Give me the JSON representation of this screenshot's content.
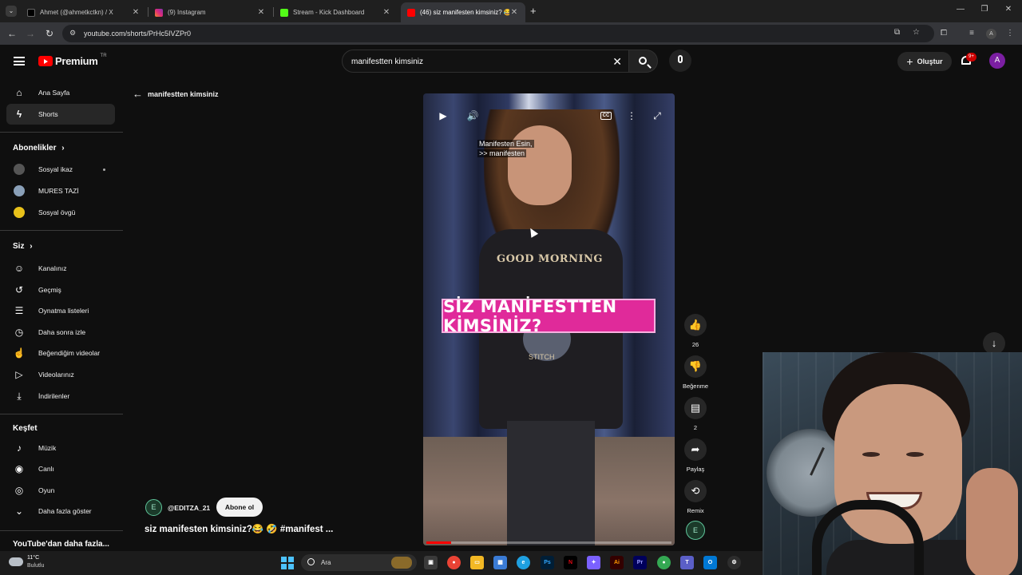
{
  "browser": {
    "tabs": [
      {
        "title": "Ahmet (@ahmetkctkn) / X",
        "icon_color": "#000000"
      },
      {
        "title": "(9) Instagram",
        "icon_color": "#e1306c"
      },
      {
        "title": "Stream - Kick Dashboard",
        "icon_color": "#53fc18"
      },
      {
        "title": "(46) siz manifesten kimsiniz? 😂",
        "icon_color": "#ff0000"
      }
    ],
    "url": "youtube.com/shorts/PrHc5IVZPr0"
  },
  "header": {
    "brand": "Premium",
    "region": "TR",
    "search_value": "manifestten kimsiniz",
    "create_label": "Oluştur",
    "notif_count": "9+",
    "avatar_letter": "A"
  },
  "sidebar": {
    "main": [
      {
        "label": "Ana Sayfa",
        "icon": "home-icon"
      },
      {
        "label": "Shorts",
        "icon": "shorts-icon"
      }
    ],
    "subscriptions_heading": "Abonelikler",
    "subscriptions": [
      {
        "label": "Sosyal ikaz",
        "color": "#555555"
      },
      {
        "label": "MURES TAZİ",
        "color": "#8aa0b8"
      },
      {
        "label": "Sosyal övgü",
        "color": "#e8c11a"
      }
    ],
    "you_heading": "Siz",
    "you": [
      {
        "label": "Kanalınız",
        "icon": "channel-icon",
        "glyph": "☺"
      },
      {
        "label": "Geçmiş",
        "icon": "history-icon",
        "glyph": "↺"
      },
      {
        "label": "Oynatma listeleri",
        "icon": "playlist-icon",
        "glyph": "☰"
      },
      {
        "label": "Daha sonra izle",
        "icon": "clock-icon",
        "glyph": "◷"
      },
      {
        "label": "Beğendiğim videolar",
        "icon": "thumbs-up-icon",
        "glyph": "👍"
      },
      {
        "label": "Videolarınız",
        "icon": "video-icon",
        "glyph": "▷"
      },
      {
        "label": "İndirilenler",
        "icon": "download-icon",
        "glyph": "⤓"
      }
    ],
    "explore_heading": "Keşfet",
    "explore": [
      {
        "label": "Müzik",
        "icon": "music-icon",
        "glyph": "♪"
      },
      {
        "label": "Canlı",
        "icon": "live-icon",
        "glyph": "◉"
      },
      {
        "label": "Oyun",
        "icon": "gaming-icon",
        "glyph": "◎"
      },
      {
        "label": "Daha fazla göster",
        "icon": "chevron-down-icon",
        "glyph": "⌄"
      }
    ],
    "more_heading": "YouTube'dan daha fazla..."
  },
  "main": {
    "back_label": "manifestten kimsiniz",
    "video": {
      "caption_line1": "Manifesten Esin,",
      "caption_line2": ">> manifesten",
      "banner": "SİZ MANİFESTTEN KİMSİNİZ?",
      "shirt_text": "GOOD MORNING",
      "shirt_small": "STITCH",
      "progress": 0.1
    },
    "actions": {
      "like_count": "26",
      "dislike_label": "Beğenme",
      "comment_count": "2",
      "share_label": "Paylaş",
      "remix_label": "Remix"
    },
    "channel": {
      "handle": "@EDITZA_21",
      "subscribe_label": "Abone ol",
      "avatar_letter": "E"
    },
    "title": "siz manifesten kimsiniz?😂 🤣 #manifest ..."
  },
  "taskbar": {
    "temp": "11°C",
    "weather": "Bulutlu",
    "search_placeholder": "Ara"
  }
}
